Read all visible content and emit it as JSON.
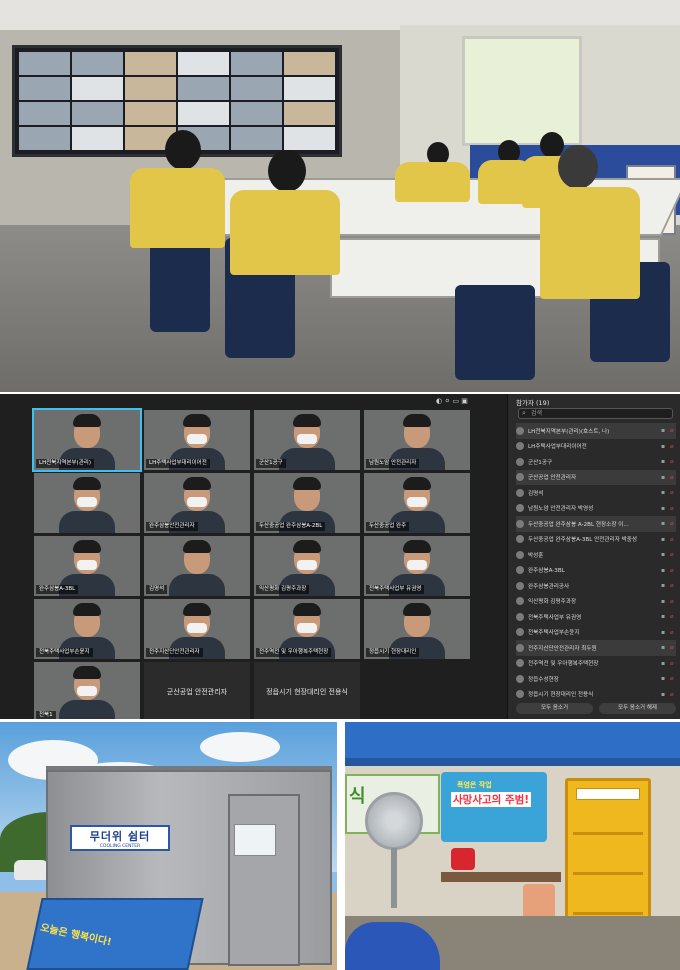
{
  "conference": {
    "tiles": [
      {
        "name": "LH전북지역본부(관리)",
        "active": true
      },
      {
        "name": "LH주택사업부대리이어전",
        "active": false
      },
      {
        "name": "군산1공구",
        "active": false
      },
      {
        "name": "남원노암 안전관리자",
        "active": false
      },
      {
        "name": "",
        "active": false
      },
      {
        "name": "완주삼봉안전관리자",
        "active": false
      },
      {
        "name": "두산중공업 완주삼봉A-2BL",
        "active": false
      },
      {
        "name": "두산중공업 완주",
        "active": false
      },
      {
        "name": "완주삼봉A-3BL",
        "active": false
      },
      {
        "name": "김명석",
        "active": false
      },
      {
        "name": "익산평화 김평주과장",
        "active": false
      },
      {
        "name": "전북주택사업부 유권영",
        "active": false
      },
      {
        "name": "전북주택사업부손윤지",
        "active": false
      },
      {
        "name": "전주지산단안전관리자",
        "active": false
      },
      {
        "name": "전주역전 및 우아행복주택현장",
        "active": false
      },
      {
        "name": "정읍시기 현장대리인",
        "active": false
      },
      {
        "name": "전북1",
        "active": false
      },
      {
        "name": "군산공업 안전관리자",
        "active": false,
        "text_only": true
      },
      {
        "name": "정읍시기 현장대리인 전용식",
        "active": false,
        "text_only": true
      }
    ],
    "sidebar": {
      "title": "참가자 (19)",
      "search_placeholder": "검색",
      "participants": [
        {
          "name": "LH전북지역본부(관리)(호스트, 나)",
          "highlight": true
        },
        {
          "name": "LH주택사업부대리이어전",
          "highlight": false
        },
        {
          "name": "군산1공구",
          "highlight": false
        },
        {
          "name": "군산공업 안전관리자",
          "highlight": true
        },
        {
          "name": "김명석",
          "highlight": false
        },
        {
          "name": "남원노암 안전관리자 박영성",
          "highlight": false
        },
        {
          "name": "두산중공업 완주삼봉 A-2BL 현장소장 이...",
          "highlight": true
        },
        {
          "name": "두산중공업 완주삼봉A-3BL 안전관리자 박중성",
          "highlight": false
        },
        {
          "name": "박성훈",
          "highlight": false
        },
        {
          "name": "완주삼봉A-3BL",
          "highlight": false
        },
        {
          "name": "완주삼봉관리공사",
          "highlight": false
        },
        {
          "name": "익산평화 김평주과장",
          "highlight": false
        },
        {
          "name": "전북주택사업부 유권영",
          "highlight": false
        },
        {
          "name": "전북주택사업부손윤지",
          "highlight": false
        },
        {
          "name": "전주지산단안전관리자 최두원",
          "highlight": true
        },
        {
          "name": "전주역전 및 우아행복주택현장",
          "highlight": false
        },
        {
          "name": "정읍수성현장",
          "highlight": false
        },
        {
          "name": "정읍시기 현장대리인 전용식",
          "highlight": false
        }
      ],
      "buttons": [
        "모두 음소거",
        "모두 음소거 해제"
      ]
    }
  },
  "shelter": {
    "sign_main": "무더위 쉼터",
    "sign_sub": "COOLING CENTER",
    "bench_text": "오늘은 행복이다!"
  },
  "station": {
    "green_banner": "식",
    "banner_line1": "폭염은 작업",
    "banner_line2": "사망사고의 주범!"
  }
}
